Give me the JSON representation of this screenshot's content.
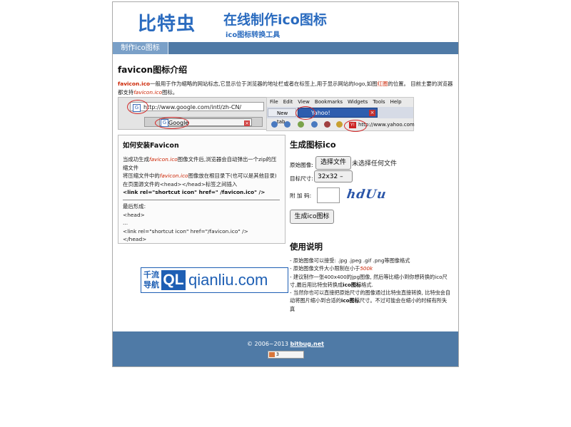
{
  "header": {
    "logo": "比特虫",
    "title": "在线制作ico图标",
    "subtitle": "ico图标转换工具"
  },
  "nav": {
    "active_tab": "制作ico图标"
  },
  "intro": {
    "title": "favicon图标介绍",
    "brand": "favicon.ico",
    "text_a": "一般用于作为缩略的网站标志,它显示位于浏览器的地址栏或者在标签上,用于显示网站的logo,如图",
    "red_word": "红圈",
    "text_b": "的位置。 目前主要的浏览器都支持",
    "favicon_italic": "favicon.ico",
    "text_c": "图标。"
  },
  "browser1": {
    "url": "http://www.google.com/intl/zh-CN/",
    "tab_title": "Google"
  },
  "browser2": {
    "menu": [
      "File",
      "Edit",
      "View",
      "Bookmarks",
      "Widgets",
      "Tools",
      "Help"
    ],
    "new_tab": "New tab",
    "yahoo_tab": "Yahoo!",
    "url": "http://www.yahoo.com"
  },
  "install": {
    "title": "如何安装Favicon",
    "line1a": "当成功生成",
    "favicon": "favicon.ico",
    "line1b": "图像文件后,浏览器会自动弹出一个zip的压缩文件",
    "line2a": "将压缩文件中的",
    "line2b": "图像放在根目录下(也可以是其他目录)",
    "line3": "在页面源文件的<head></head>标签之间插入",
    "code1": "<link rel=\"shortcut icon\" href=\" /favicon.ico\" />",
    "final_label": "最后形成:",
    "head_open": "<head>",
    "dots": "...",
    "code2": "<link rel=\"shortcut icon\" href=\"/favicon.ico\" />",
    "head_close": "</head>"
  },
  "generator": {
    "title": "生成图标ico",
    "source_label": "原始图像:",
    "file_button": "选择文件",
    "no_file": "未选择任何文件",
    "size_label": "目标尺寸:",
    "size_value": "32x32 –",
    "captcha_label": "附 加 码:",
    "captcha_text": "hdUu",
    "submit": "生成ico图标"
  },
  "usage": {
    "title": "使用说明",
    "item1": "- 原始图像可以接受: .jpg .jpeg .gif .png等图像格式",
    "item2a": "- 原始图像文件大小限制在小于",
    "item2_limit": "500k",
    "item3a": "- 建议制作一张400x400的jpg图像, 然后等比缩小到你想转换的ico尺寸,最后用比特虫转换成",
    "item3_bold": "ico图标",
    "item3b": "格式.",
    "item4a": "- 当然你也可以直接把原始尺寸的图像通过比特虫直接转换, 比特虫会自动将图片缩小到合适的",
    "item4_bold": "ico图标",
    "item4b": "尺寸。不过可能会在缩小的时候有所失真"
  },
  "partner": {
    "cn_line1": "千流",
    "cn_line2": "导航",
    "mark": "QL",
    "domain": "qianliu.com"
  },
  "footer": {
    "copyright": "© 2006~2013",
    "site": "bitbug.net",
    "counter": "3"
  },
  "colors": {
    "brand_blue": "#2a6bbf",
    "nav_bar": "#4f7aa6",
    "highlight_red": "#cc2200"
  }
}
